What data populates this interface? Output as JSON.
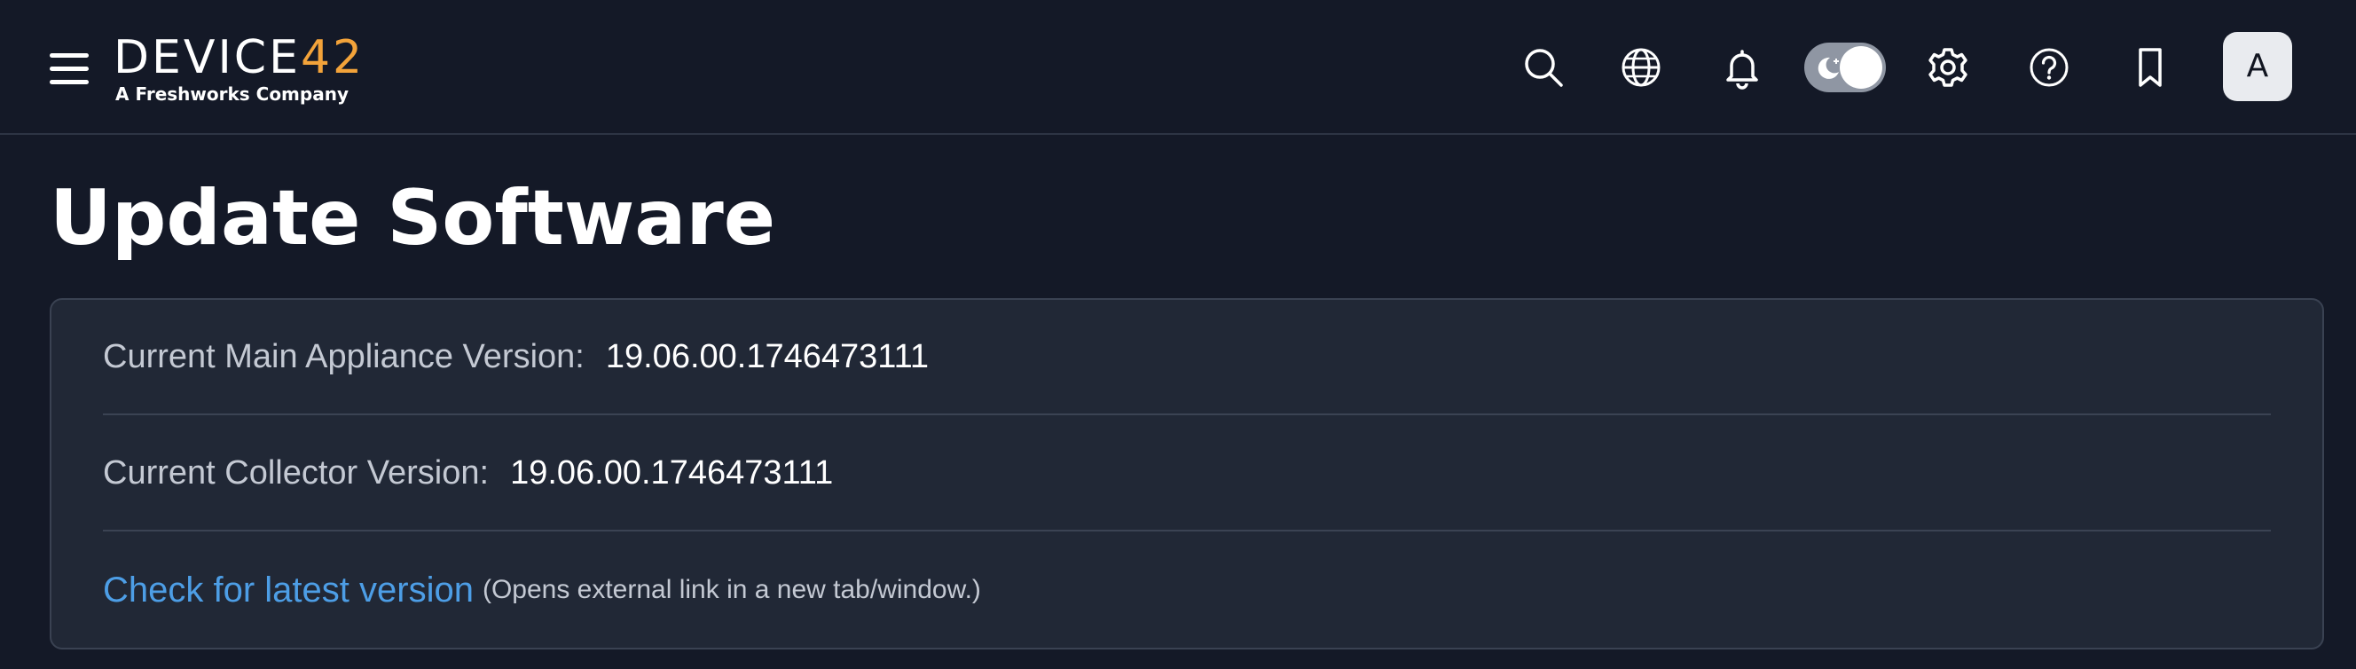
{
  "header": {
    "logo": {
      "wordmark_main": "DEVICE",
      "wordmark_accent": "42",
      "tagline": "A Freshworks Company"
    },
    "icons": [
      "menu-icon",
      "search-icon",
      "globe-icon",
      "bell-icon",
      "moon-icon",
      "gear-icon",
      "help-icon",
      "bookmark-icon"
    ],
    "avatar_initial": "A"
  },
  "page": {
    "title": "Update Software"
  },
  "versions": {
    "main_appliance_label": "Current Main Appliance Version:",
    "main_appliance_value": "19.06.00.1746473111",
    "collector_label": "Current Collector Version:",
    "collector_value": "19.06.00.1746473111"
  },
  "links": {
    "check_latest": "Check for latest version",
    "check_latest_note": "(Opens external link in a new tab/window.)"
  },
  "colors": {
    "background": "#141927",
    "card": "#212836",
    "brand_accent": "#f3a33a",
    "link": "#4d9ee6"
  }
}
